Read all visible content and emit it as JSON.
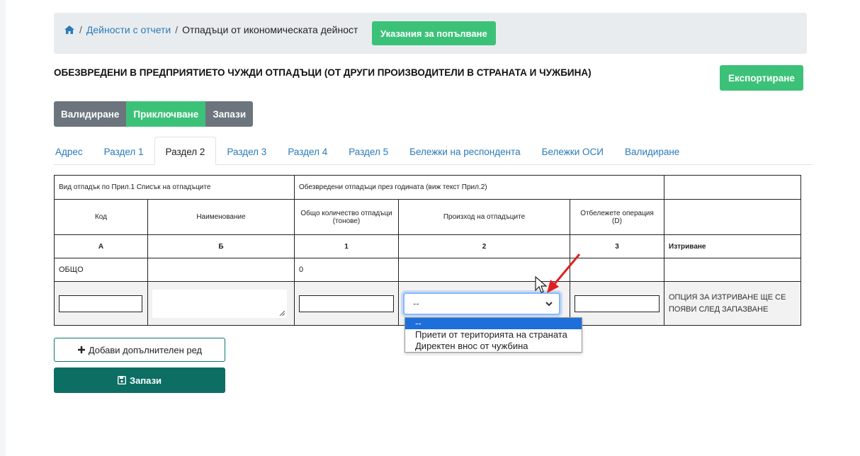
{
  "breadcrumb": {
    "home_icon": "home-icon",
    "link": "Дейности с отчети",
    "current": "Отпадъци от икономическата дейност",
    "help_button": "Указания за попълване"
  },
  "section_title": "ОБЕЗВРЕДЕНИ В ПРЕДПРИЯТИЕТО ЧУЖДИ ОТПАДЪЦИ (ОТ ДРУГИ ПРОИЗВОДИТЕЛИ В СТРАНАТА И ЧУЖБИНА)",
  "export_button": "Експортиране",
  "actions": {
    "validate": "Валидиране",
    "finish": "Приключване",
    "save": "Запази"
  },
  "tabs": [
    "Адрес",
    "Раздел 1",
    "Раздел 2",
    "Раздел 3",
    "Раздел 4",
    "Раздел 5",
    "Бележки на респондента",
    "Бележки ОСИ",
    "Валидиране"
  ],
  "active_tab": "Раздел 2",
  "table": {
    "group_left": "Вид отпадък по Прил.1 Списък на отпадъците",
    "group_right": "Обезвредени отпадъци през годината (виж текст Прил.2)",
    "headers": [
      "Код",
      "Наименование",
      "Общо количество отпадъци (тонове)",
      "Произход на отпадъците",
      "Отбележете операция (D)",
      ""
    ],
    "letters": [
      "А",
      "Б",
      "1",
      "2",
      "3",
      "Изтриване"
    ],
    "total_row": {
      "label": "ОБЩО",
      "quantity": "0"
    },
    "input_row": {
      "select_value": "--",
      "delete_note": "ОПЦИЯ ЗА ИЗТРИВАНЕ ЩЕ СЕ ПОЯВИ СЛЕД ЗАПАЗВАНЕ"
    }
  },
  "dropdown_options": [
    "--",
    "Приети от територията на страната",
    "Директен внос от чужбина"
  ],
  "dropdown_selected": "--",
  "add_row_button": "Добави допълнителен ред",
  "save_button": "Запази",
  "colors": {
    "green": "#3cc278",
    "teal": "#0d6e64",
    "link": "#2a7ab8",
    "gray": "#6c757d",
    "arrow": "#e02020"
  }
}
